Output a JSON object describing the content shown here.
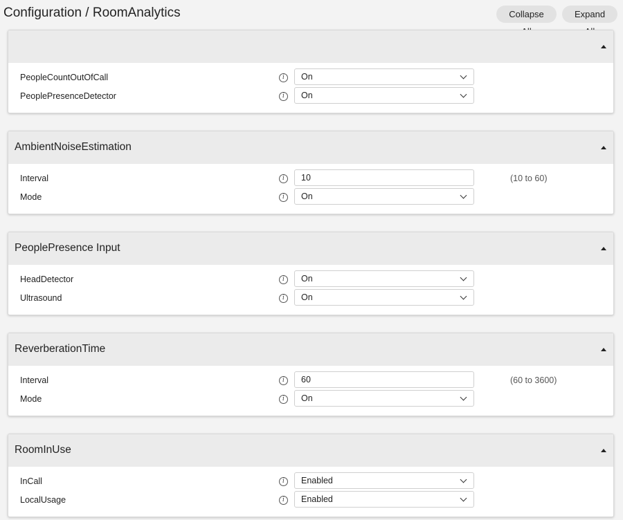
{
  "header": {
    "title": "Configuration / RoomAnalytics",
    "collapse_all_label": "Collapse All",
    "expand_all_label": "Expand All"
  },
  "sections": [
    {
      "title": "",
      "rows": [
        {
          "label": "PeopleCountOutOfCall",
          "type": "select",
          "value": "On"
        },
        {
          "label": "PeoplePresenceDetector",
          "type": "select",
          "value": "On"
        }
      ]
    },
    {
      "title": "AmbientNoiseEstimation",
      "rows": [
        {
          "label": "Interval",
          "type": "input",
          "value": "10",
          "range": "(10 to 60)"
        },
        {
          "label": "Mode",
          "type": "select",
          "value": "On"
        }
      ]
    },
    {
      "title": "PeoplePresence Input",
      "rows": [
        {
          "label": "HeadDetector",
          "type": "select",
          "value": "On"
        },
        {
          "label": "Ultrasound",
          "type": "select",
          "value": "On"
        }
      ]
    },
    {
      "title": "ReverberationTime",
      "rows": [
        {
          "label": "Interval",
          "type": "input",
          "value": "60",
          "range": "(60 to 3600)"
        },
        {
          "label": "Mode",
          "type": "select",
          "value": "On"
        }
      ]
    },
    {
      "title": "RoomInUse",
      "rows": [
        {
          "label": "InCall",
          "type": "select",
          "value": "Enabled"
        },
        {
          "label": "LocalUsage",
          "type": "select",
          "value": "Enabled"
        }
      ]
    }
  ],
  "icons": {
    "info": "info-icon",
    "dropdown": "chevron-down-icon",
    "collapse": "collapse-triangle-icon"
  }
}
